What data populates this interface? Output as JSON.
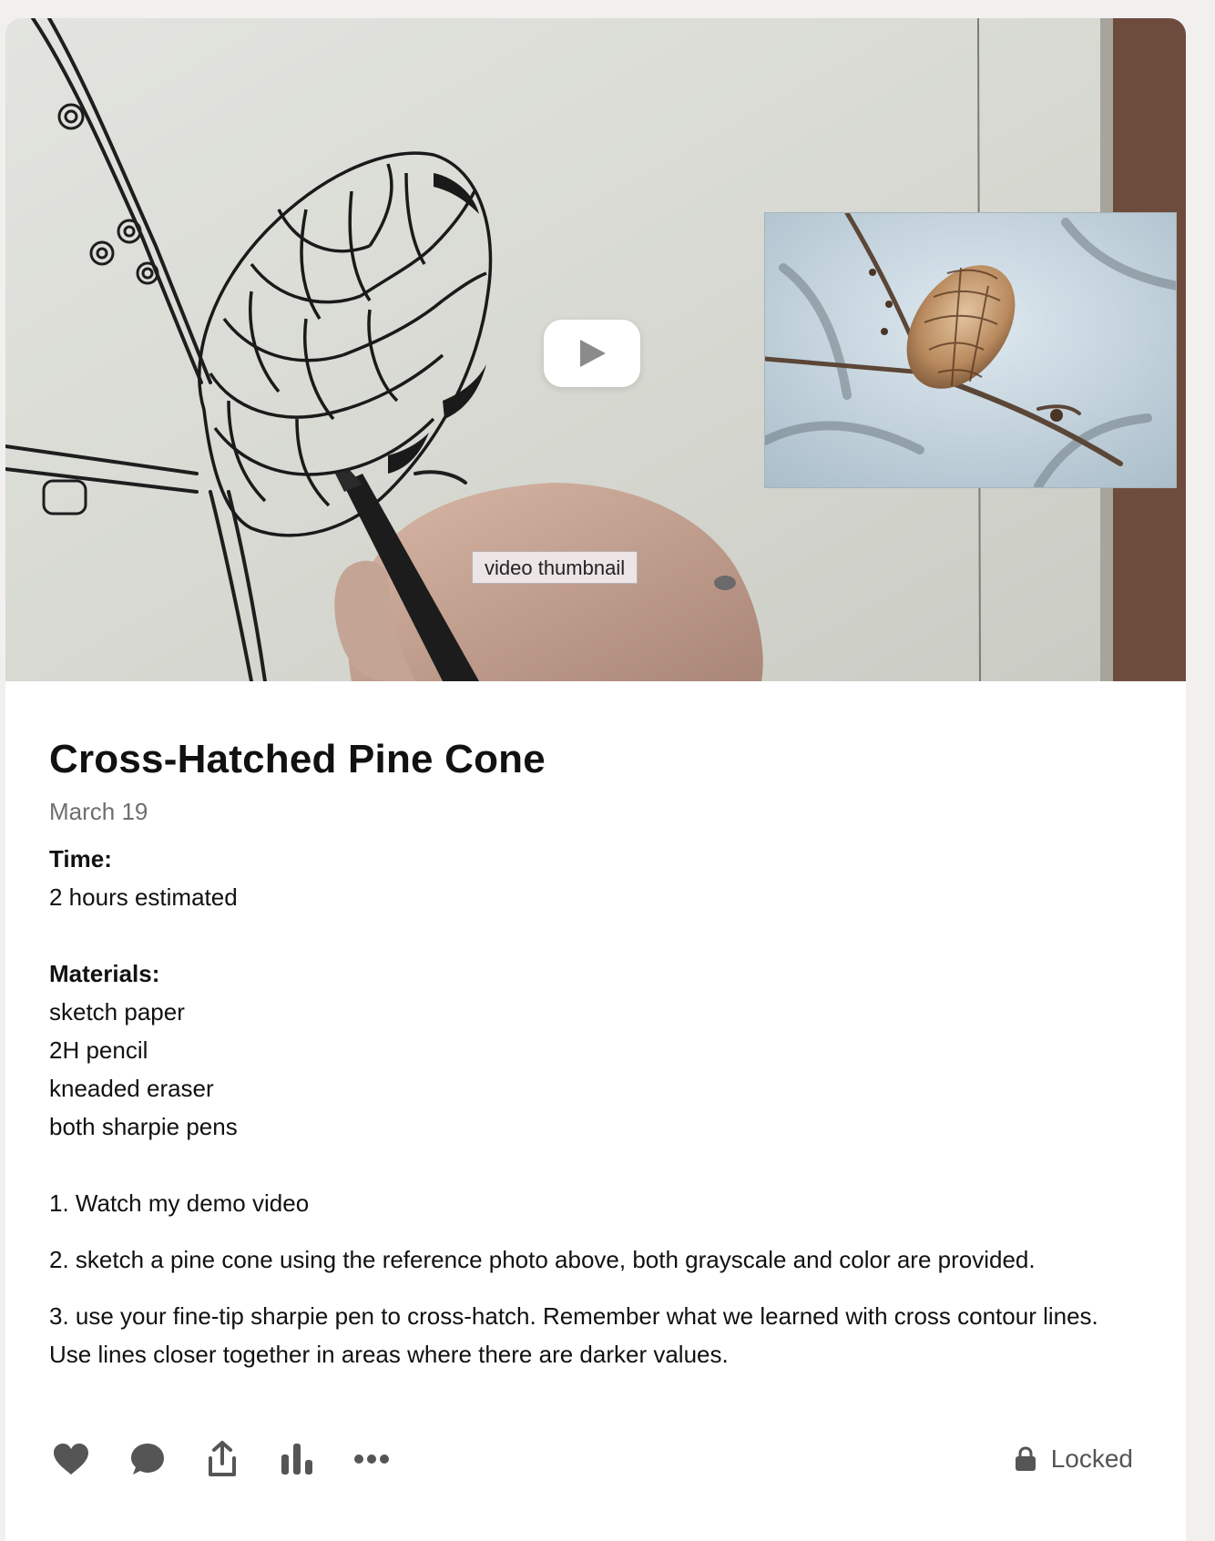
{
  "media": {
    "thumbnail_label": "video thumbnail",
    "play_icon": "play-icon"
  },
  "post": {
    "title": "Cross-Hatched Pine Cone",
    "date": "March 19",
    "time_heading": "Time:",
    "time_value": "2 hours estimated",
    "materials_heading": "Materials:",
    "materials": [
      "sketch paper",
      "2H pencil",
      "kneaded eraser",
      "both sharpie pens"
    ],
    "steps": [
      "1. Watch my demo video",
      "2. sketch a pine cone using the reference photo above, both grayscale and color are provided.",
      "3. use your fine-tip sharpie pen to cross-hatch. Remember what we learned with cross contour lines. Use lines closer together in areas where there are darker values."
    ]
  },
  "actions": {
    "icons": [
      "heart-icon",
      "comment-icon",
      "share-icon",
      "stats-icon",
      "more-icon"
    ],
    "lock_label": "Locked",
    "lock_icon": "lock-icon"
  },
  "colors": {
    "page_background": "#f2efef",
    "card_background": "#ffffff",
    "text": "#111111",
    "muted_text": "#6f6f6f",
    "icon": "#555555"
  }
}
